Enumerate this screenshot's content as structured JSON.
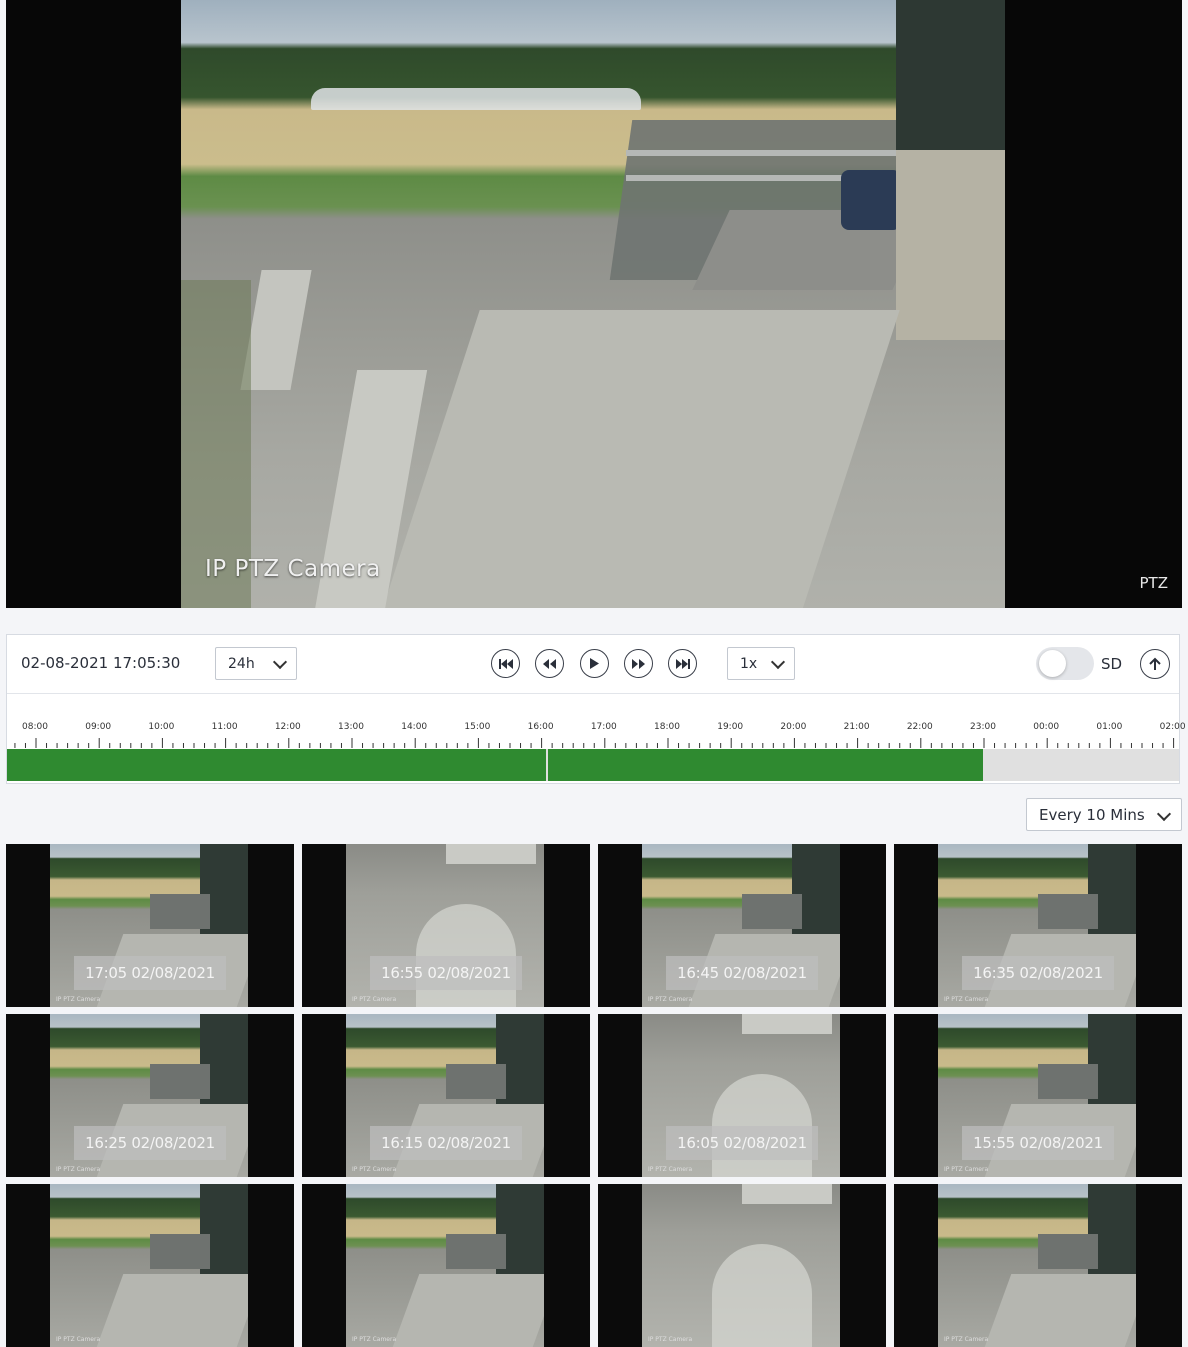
{
  "player": {
    "camera_label": "IP PTZ Camera",
    "ptz_label": "PTZ"
  },
  "controls": {
    "datetime": "02-08-2021 17:05:30",
    "range_select": "24h",
    "speed_select": "1x",
    "quality_label": "SD",
    "quality_hd_enabled": false
  },
  "timeline": {
    "hours": [
      "08:00",
      "09:00",
      "10:00",
      "11:00",
      "12:00",
      "13:00",
      "14:00",
      "15:00",
      "16:00",
      "17:00",
      "18:00",
      "19:00",
      "20:00",
      "21:00",
      "22:00",
      "23:00",
      "00:00",
      "01:00",
      "02:00"
    ],
    "recorded_color": "#2f8a30",
    "empty_color": "#e0e0e0"
  },
  "interval_select": "Every 10 Mins",
  "thumbnails": [
    {
      "time": "17:05 02/08/2021",
      "scene": "field"
    },
    {
      "time": "16:55 02/08/2021",
      "scene": "ground"
    },
    {
      "time": "16:45 02/08/2021",
      "scene": "field"
    },
    {
      "time": "16:35 02/08/2021",
      "scene": "field"
    },
    {
      "time": "16:25 02/08/2021",
      "scene": "field"
    },
    {
      "time": "16:15 02/08/2021",
      "scene": "field"
    },
    {
      "time": "16:05 02/08/2021",
      "scene": "ground"
    },
    {
      "time": "15:55 02/08/2021",
      "scene": "field"
    },
    {
      "time": "",
      "scene": "field"
    },
    {
      "time": "",
      "scene": "field"
    },
    {
      "time": "",
      "scene": "ground"
    },
    {
      "time": "",
      "scene": "field"
    }
  ],
  "thumb_overlay_text": "IP PTZ Camera"
}
